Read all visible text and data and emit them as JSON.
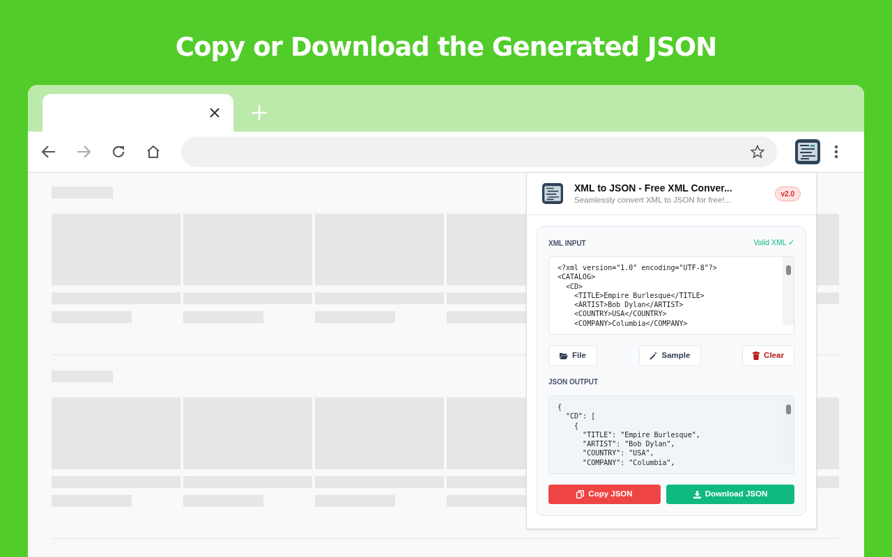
{
  "headline": "Copy or Download the Generated JSON",
  "popup": {
    "title": "XML to JSON - Free XML Conver...",
    "subtitle": "Seamlessly convert XML to JSON for free!...",
    "version": "v2.0",
    "input": {
      "label": "XML INPUT",
      "status": "Valid XML ✓",
      "lines": [
        "<?xml version=\"1.0\" encoding=\"UTF-8\"?>",
        "<CATALOG>",
        "  <CD>",
        "    <TITLE>Empire Burlesque</TITLE>",
        "    <ARTIST>Bob Dylan</ARTIST>",
        "    <COUNTRY>USA</COUNTRY>",
        "    <COMPANY>Columbia</COMPANY>"
      ]
    },
    "tools": [
      {
        "kind": "file",
        "label": "File"
      },
      {
        "kind": "sample",
        "label": "Sample"
      },
      {
        "kind": "clear",
        "label": "Clear"
      }
    ],
    "output": {
      "label": "JSON OUTPUT",
      "lines": [
        "{",
        "  \"CD\": [",
        "    {",
        "      \"TITLE\": \"Empire Burlesque\",",
        "      \"ARTIST\": \"Bob Dylan\",",
        "      \"COUNTRY\": \"USA\",",
        "      \"COMPANY\": \"Columbia\","
      ]
    },
    "actions": [
      {
        "kind": "copy",
        "label": "Copy JSON"
      },
      {
        "kind": "download",
        "label": "Download JSON"
      }
    ]
  }
}
